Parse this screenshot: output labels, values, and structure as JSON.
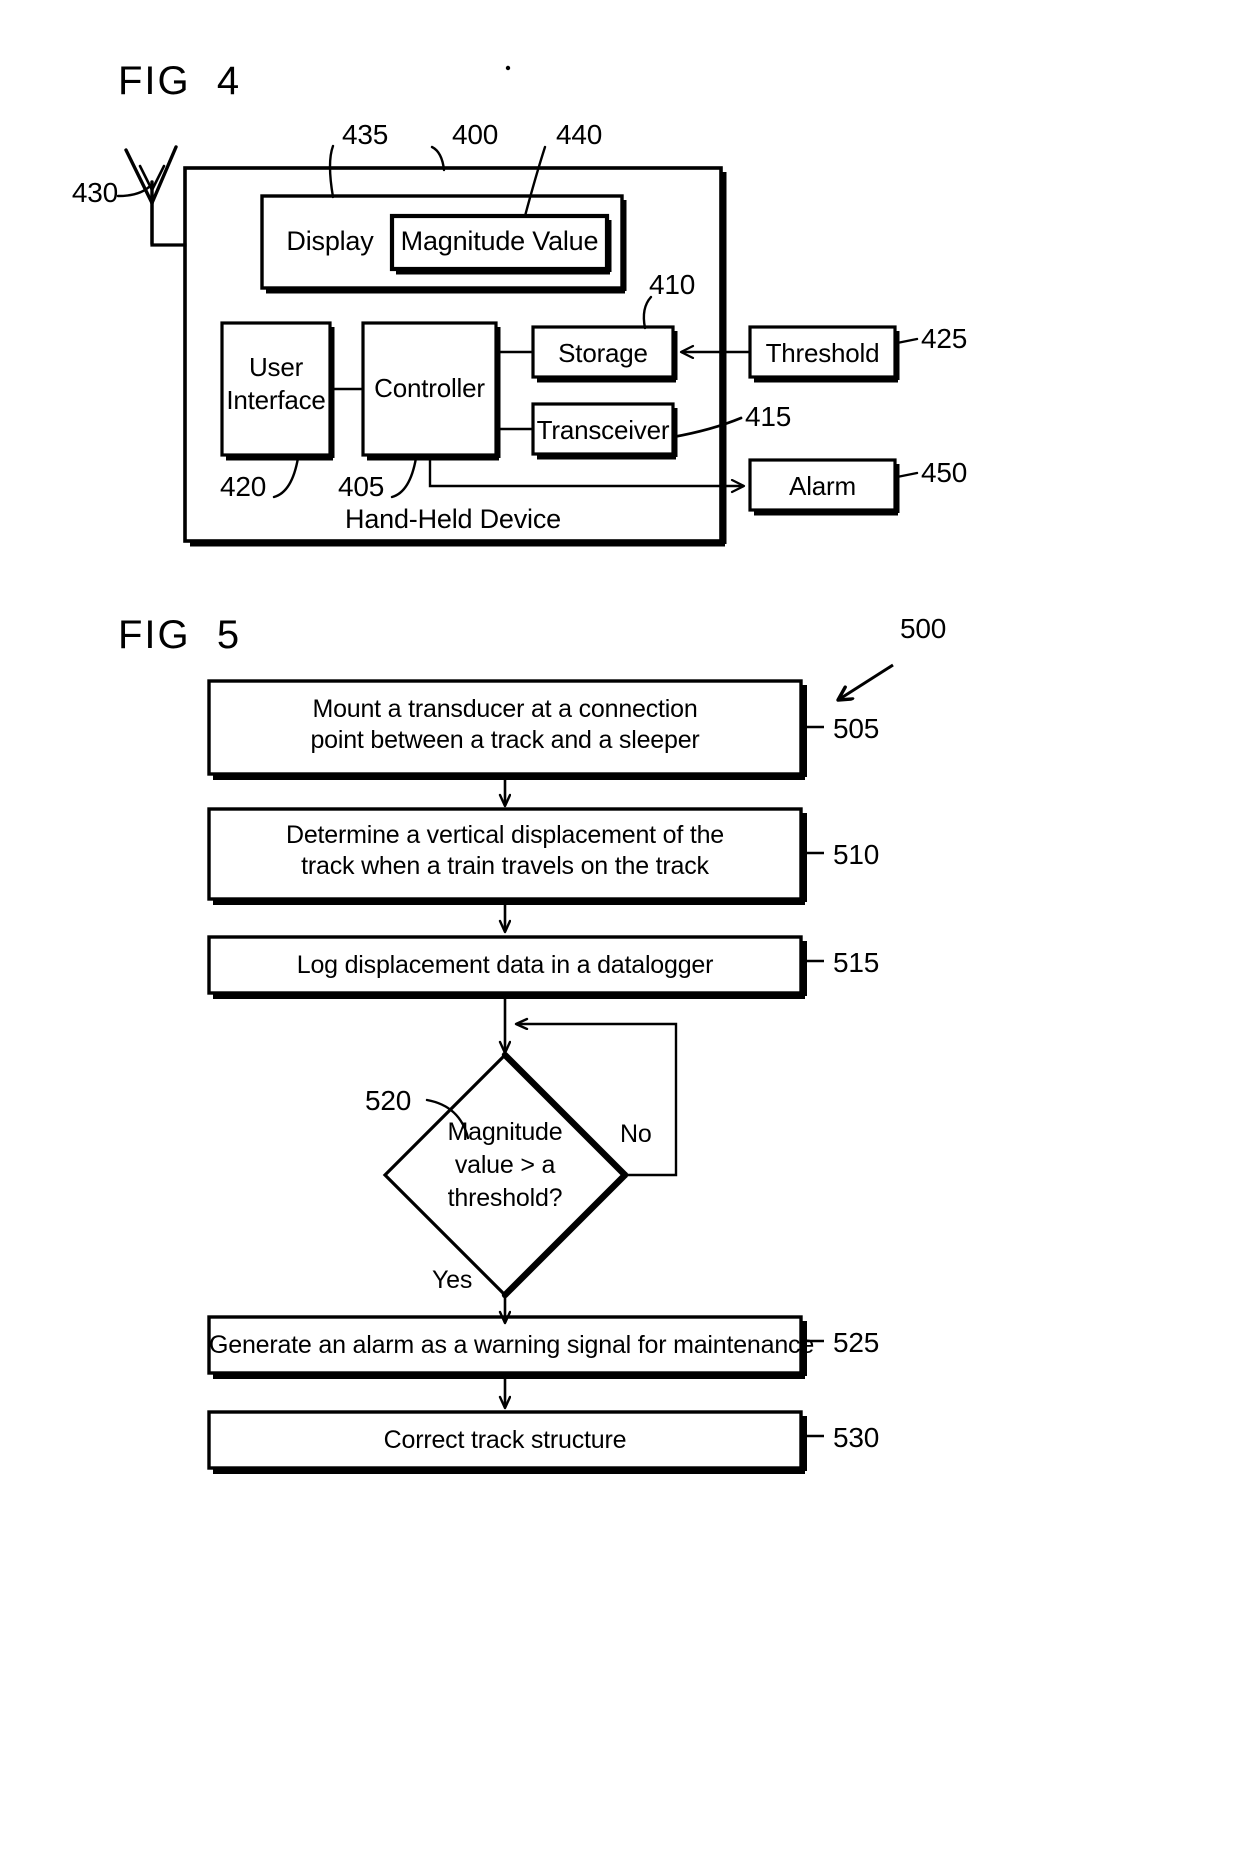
{
  "figures": [
    {
      "id": "fig4",
      "label": "FIG  4",
      "caption": "Hand-Held Device",
      "blocks": {
        "display": "Display",
        "magnitude_value": "Magnitude Value",
        "user_interface": "User\nInterface",
        "user_interface_line1": "User",
        "user_interface_line2": "Interface",
        "controller": "Controller",
        "storage": "Storage",
        "transceiver": "Transceiver",
        "threshold": "Threshold",
        "alarm": "Alarm"
      },
      "reference_numerals": {
        "antenna": "430",
        "display": "435",
        "device": "400",
        "magnitude_value": "440",
        "storage": "410",
        "threshold": "425",
        "transceiver": "415",
        "alarm": "450",
        "user_interface": "420",
        "controller": "405"
      }
    },
    {
      "id": "fig5",
      "label": "FIG  5",
      "reference_numerals": {
        "method": "500",
        "step1": "505",
        "step2": "510",
        "step3": "515",
        "decision": "520",
        "step4": "525",
        "step5": "530"
      },
      "steps": [
        {
          "ref": "505",
          "line1": "Mount a transducer at a connection",
          "line2": "point between a track and a sleeper"
        },
        {
          "ref": "510",
          "line1": "Determine a vertical displacement of the",
          "line2": "track when a train travels on the track"
        },
        {
          "ref": "515",
          "line1": "Log displacement data in a datalogger",
          "line2": ""
        },
        {
          "ref": "525",
          "line1": "Generate an alarm as a warning signal for maintenance",
          "line2": ""
        },
        {
          "ref": "530",
          "line1": "Correct track structure",
          "line2": ""
        }
      ],
      "decision": {
        "ref": "520",
        "line1": "Magnitude",
        "line2": "value > a",
        "line3": "threshold?",
        "yes_label": "Yes",
        "no_label": "No"
      }
    }
  ],
  "style": {
    "ink": "#000000",
    "paper": "#ffffff"
  }
}
